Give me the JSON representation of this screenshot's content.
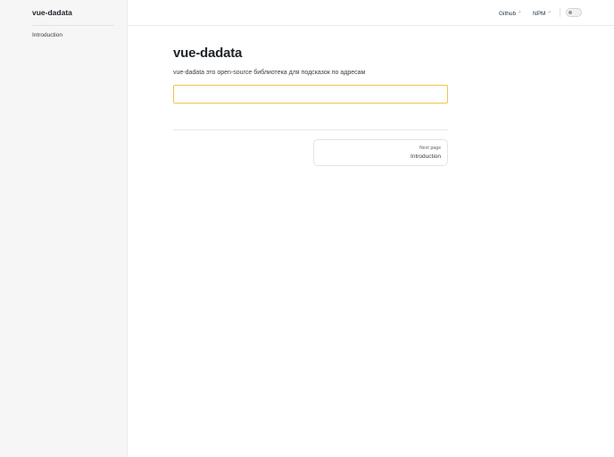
{
  "sidebar": {
    "logo": "vue-dadata",
    "items": [
      {
        "label": "Introduction"
      }
    ]
  },
  "header": {
    "nav": [
      {
        "label": "Github",
        "icon": "external-link-icon",
        "ext": "↗"
      },
      {
        "label": "NPM",
        "icon": "external-link-icon",
        "ext": "↗"
      }
    ],
    "theme_toggle": {
      "icon": "sun-icon"
    }
  },
  "main": {
    "title": "vue-dadata",
    "description": "vue-dadata это open-source библиотека для подсказок по адресам",
    "input": {
      "value": "",
      "placeholder": ""
    },
    "pager": {
      "desc": "Next page",
      "title": "Introduction"
    }
  },
  "colors": {
    "input_border": "#f0c24a",
    "sidebar_bg": "#f6f6f7"
  }
}
